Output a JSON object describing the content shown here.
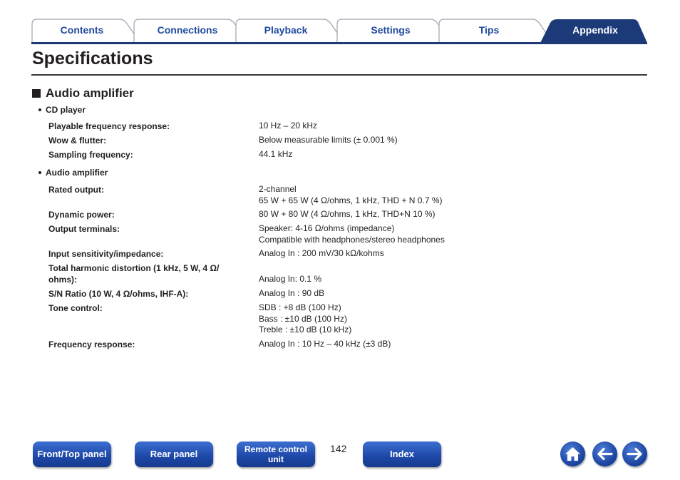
{
  "tabs": [
    {
      "label": "Contents",
      "active": false
    },
    {
      "label": "Connections",
      "active": false
    },
    {
      "label": "Playback",
      "active": false
    },
    {
      "label": "Settings",
      "active": false
    },
    {
      "label": "Tips",
      "active": false
    },
    {
      "label": "Appendix",
      "active": true
    }
  ],
  "page_title": "Specifications",
  "section": {
    "title": "Audio amplifier"
  },
  "groups": [
    {
      "heading": "CD player",
      "rows": [
        {
          "label": "Playable frequency response:",
          "values": [
            "10 Hz – 20 kHz"
          ]
        },
        {
          "label": "Wow & flutter:",
          "values": [
            "Below measurable limits (± 0.001 %)"
          ]
        },
        {
          "label": "Sampling frequency:",
          "values": [
            "44.1 kHz"
          ]
        }
      ]
    },
    {
      "heading": "Audio amplifier",
      "rows": [
        {
          "label": "Rated output:",
          "values": [
            "2-channel",
            "65 W + 65 W (4 Ω/ohms, 1 kHz, THD + N 0.7 %)"
          ]
        },
        {
          "label": "Dynamic power:",
          "values": [
            "80 W + 80 W (4 Ω/ohms, 1 kHz, THD+N 10 %)"
          ]
        },
        {
          "label": "Output terminals:",
          "values": [
            "Speaker: 4-16 Ω/ohms (impedance)",
            "Compatible with headphones/stereo headphones"
          ]
        },
        {
          "label": "Input sensitivity/impedance:",
          "values": [
            "Analog In : 200 mV/30 kΩ/kohms"
          ]
        },
        {
          "label": "Total harmonic distortion (1 kHz, 5 W, 4 Ω/ ohms):",
          "values": [
            "Analog In: 0.1 %"
          ]
        },
        {
          "label": "S/N Ratio (10 W, 4 Ω/ohms, IHF-A):",
          "values": [
            "Analog In : 90 dB"
          ]
        },
        {
          "label": "Tone control:",
          "values": [
            "SDB : +8 dB (100 Hz)",
            "Bass : ±10 dB (100 Hz)",
            "Treble : ±10 dB (10 kHz)"
          ]
        },
        {
          "label": "Frequency response:",
          "values": [
            "Analog In : 10 Hz – 40 kHz (±3 dB)"
          ]
        }
      ]
    }
  ],
  "bottom_nav": {
    "front_top_panel": "Front/Top panel",
    "rear_panel": "Rear panel",
    "remote_control_unit": "Remote control unit",
    "page_number": "142",
    "index": "Index"
  },
  "icons": {
    "home": "home-icon",
    "back": "arrow-left-icon",
    "forward": "arrow-right-icon"
  },
  "colors": {
    "tab_text": "#1f4a9c",
    "tab_active_bg": "#1d3a78",
    "button_blue": "#1d47a8"
  }
}
